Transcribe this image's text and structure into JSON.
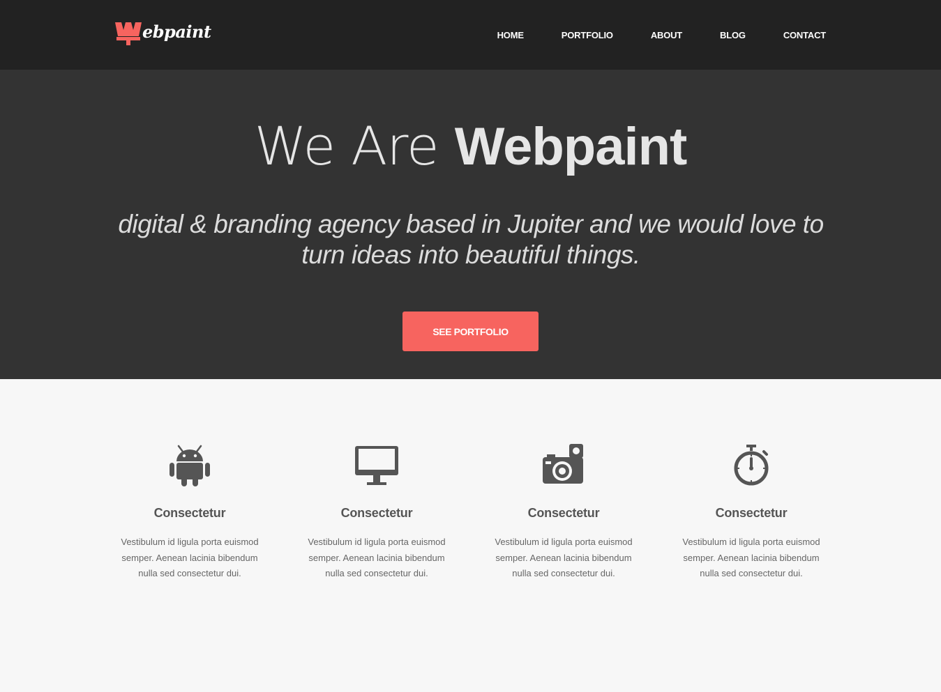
{
  "brand": {
    "logo_text": "ebpaint",
    "accent_color": "#f7645f",
    "logo_icon": "paint-brush-w-icon"
  },
  "nav": {
    "items": [
      {
        "label": "HOME"
      },
      {
        "label": "PORTFOLIO"
      },
      {
        "label": "ABOUT"
      },
      {
        "label": "BLOG"
      },
      {
        "label": "CONTACT"
      }
    ]
  },
  "hero": {
    "title_light": "We Are ",
    "title_bold": "Webpaint",
    "subtitle": "digital & branding agency based in Jupiter and we would love to turn ideas into beautiful things.",
    "button_label": "SEE PORTFOLIO"
  },
  "features": [
    {
      "icon": "android-icon",
      "title": "Consectetur",
      "text": "Vestibulum id ligula porta euismod semper. Aenean lacinia bibendum nulla sed consectetur dui."
    },
    {
      "icon": "monitor-icon",
      "title": "Consectetur",
      "text": "Vestibulum id ligula porta euismod semper. Aenean lacinia bibendum nulla sed consectetur dui."
    },
    {
      "icon": "camera-icon",
      "title": "Consectetur",
      "text": "Vestibulum id ligula porta euismod semper. Aenean lacinia bibendum nulla sed consectetur dui."
    },
    {
      "icon": "stopwatch-icon",
      "title": "Consectetur",
      "text": "Vestibulum id ligula porta euismod semper. Aenean lacinia bibendum nulla sed consectetur dui."
    }
  ]
}
